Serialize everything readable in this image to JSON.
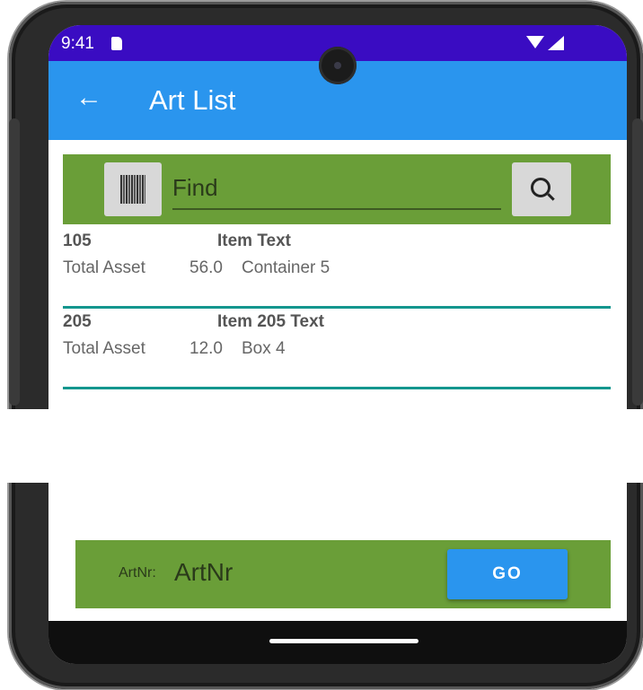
{
  "status_bar": {
    "time": "9:41"
  },
  "app_bar": {
    "title": "Art List"
  },
  "search": {
    "placeholder": "Find"
  },
  "list": {
    "items": [
      {
        "id": "105",
        "text": "Item Text",
        "label": "Total Asset",
        "quantity": "56.0",
        "location": "Container 5"
      },
      {
        "id": "205",
        "text": "Item 205 Text",
        "label": "Total Asset",
        "quantity": "12.0",
        "location": "Box 4"
      }
    ]
  },
  "bottom_bar": {
    "artnr_label": "ArtNr:",
    "artnr_value": "ArtNr",
    "go_label": "GO"
  },
  "colors": {
    "status_bar": "#3a0cc2",
    "app_bar": "#2a95ee",
    "panel_green": "#6a9e38",
    "divider": "#14968e"
  }
}
